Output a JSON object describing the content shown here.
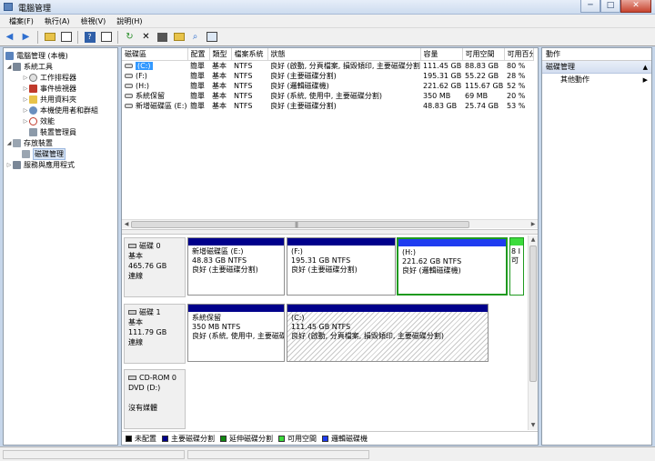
{
  "window": {
    "title": "電腦管理",
    "minimize": "─",
    "maximize": "□",
    "close": "✕"
  },
  "menu": [
    "檔案(F)",
    "執行(A)",
    "檢視(V)",
    "說明(H)"
  ],
  "toolbar": [
    "back-icon",
    "forward-icon",
    "up-folder-icon",
    "show-hide-tree-icon",
    "help-icon",
    "console-icon",
    "refresh-icon",
    "delete-icon",
    "properties-icon",
    "open-icon",
    "search-icon",
    "settings-icon"
  ],
  "tree": {
    "root": "電腦管理 (本機)",
    "system_tools": "系統工具",
    "task_scheduler": "工作排程器",
    "event_viewer": "事件檢視器",
    "shared_folders": "共用資料夾",
    "local_users": "本機使用者和群組",
    "performance": "效能",
    "device_manager": "裝置管理員",
    "storage": "存放裝置",
    "disk_management": "磁碟管理",
    "services": "服務與應用程式"
  },
  "volumes": {
    "headers": [
      "磁碟區",
      "配置",
      "類型",
      "檔案系統",
      "狀態",
      "容量",
      "可用空間",
      "可用百分"
    ],
    "rows": [
      [
        "(C:)",
        "簡單",
        "基本",
        "NTFS",
        "良好 (啟動, 分頁檔案, 損毀傾印, 主要磁碟分割)",
        "111.45 GB",
        "88.83 GB",
        "80 %"
      ],
      [
        "(F:)",
        "簡單",
        "基本",
        "NTFS",
        "良好 (主要磁碟分割)",
        "195.31 GB",
        "55.22 GB",
        "28 %"
      ],
      [
        "(H:)",
        "簡單",
        "基本",
        "NTFS",
        "良好 (邏輯磁碟機)",
        "221.62 GB",
        "115.67 GB",
        "52 %"
      ],
      [
        "系統保留",
        "簡單",
        "基本",
        "NTFS",
        "良好 (系統, 使用中, 主要磁碟分割)",
        "350 MB",
        "69 MB",
        "20 %"
      ],
      [
        "新增磁碟區 (E:)",
        "簡單",
        "基本",
        "NTFS",
        "良好 (主要磁碟分割)",
        "48.83 GB",
        "25.74 GB",
        "53 %"
      ]
    ]
  },
  "disks": {
    "disk0": {
      "name": "磁碟 0",
      "type": "基本",
      "size": "465.76 GB",
      "status": "連線",
      "parts": [
        {
          "title": "新增磁碟區 (E:)",
          "size": "48.83 GB NTFS",
          "status": "良好 (主要磁碟分割)"
        },
        {
          "title": "(F:)",
          "size": "195.31 GB NTFS",
          "status": "良好 (主要磁碟分割)"
        },
        {
          "title": "(H:)",
          "size": "221.62 GB NTFS",
          "status": "良好 (邏輯磁碟機)"
        },
        {
          "title": "",
          "size": "8 I",
          "status": "可"
        }
      ]
    },
    "disk1": {
      "name": "磁碟 1",
      "type": "基本",
      "size": "111.79 GB",
      "status": "連線",
      "parts": [
        {
          "title": "系統保留",
          "size": "350 MB NTFS",
          "status": "良好 (系統, 使用中, 主要磁碟"
        },
        {
          "title": "(C:)",
          "size": "111.45 GB NTFS",
          "status": "良好 (啟動, 分頁檔案, 損毀傾印, 主要磁碟分割)"
        }
      ]
    },
    "cdrom0": {
      "name": "CD-ROM 0",
      "type": "DVD (D:)",
      "status": "沒有媒體"
    }
  },
  "legend": [
    {
      "label": "未配置",
      "color": "#000000"
    },
    {
      "label": "主要磁碟分割",
      "color": "#00008b"
    },
    {
      "label": "延伸磁碟分割",
      "color": "#118811"
    },
    {
      "label": "可用空間",
      "color": "#3cdc3c"
    },
    {
      "label": "邏輯磁碟機",
      "color": "#1f3cf0"
    }
  ],
  "actions": {
    "header": "動作",
    "section": "磁碟管理",
    "more": "其他動作"
  },
  "colors": {
    "primary": "#00008b",
    "logical": "#1f3cf0",
    "free": "#3cdc3c",
    "extended_border": "#1f9a1f"
  }
}
